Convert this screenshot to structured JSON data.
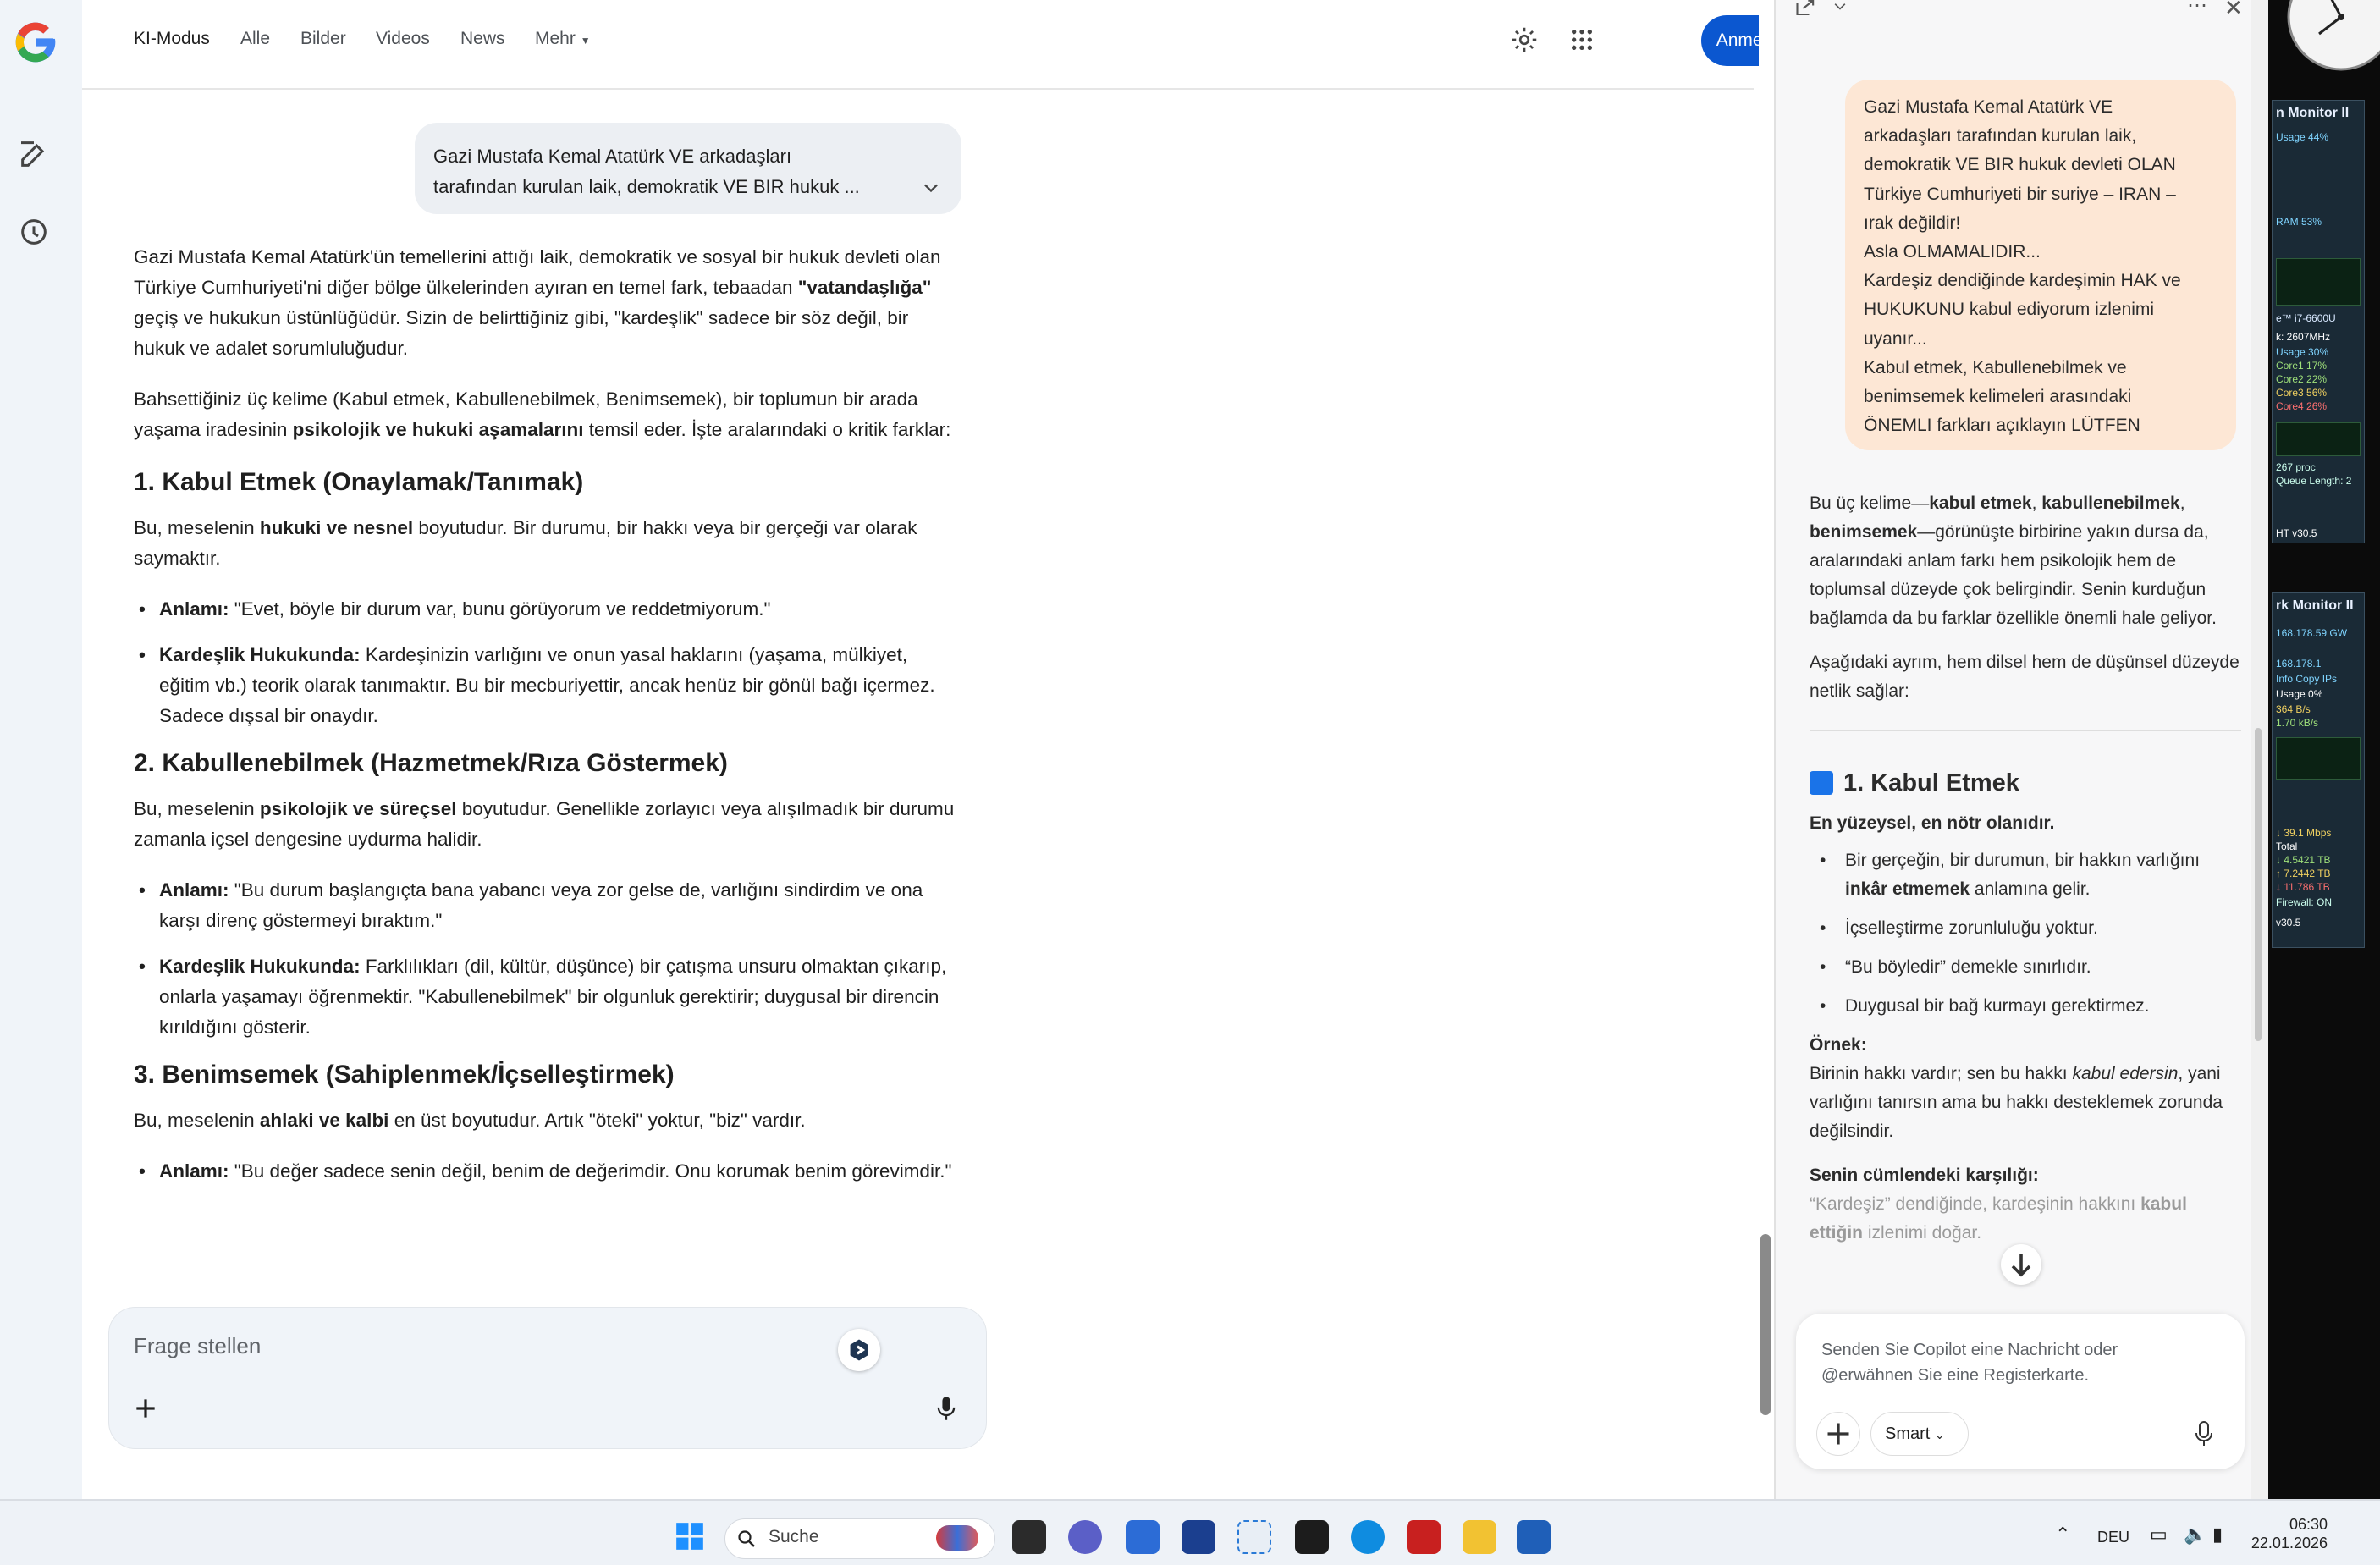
{
  "nav": {
    "tabs": [
      "KI-Modus",
      "Alle",
      "Bilder",
      "Videos",
      "News",
      "Mehr"
    ],
    "signin": "Anmelden"
  },
  "query": {
    "line1": "Gazi Mustafa Kemal Atatürk VE arkadaşları",
    "line2": "tarafından kurulan laik, demokratik VE BIR hukuk ..."
  },
  "answer": {
    "intro": [
      "Gazi Mustafa Kemal Atatürk'ün temellerini attığı laik, demokratik ve sosyal bir hukuk devleti olan Türkiye Cumhuriyeti'ni diğer bölge ülkelerinden ayıran en temel fark, tebaadan ",
      "\"vatandaşlığa\"",
      " geçiş ve hukukun üstünlüğüdür. Sizin de belirttiğiniz gibi, \"kardeşlik\" sadece bir söz değil, bir hukuk ve adalet sorumluluğudur."
    ],
    "para2": [
      "Bahsettiğiniz üç kelime (Kabul etmek, Kabullenebilmek, Benimsemek), bir toplumun bir arada yaşama iradesinin ",
      "psikolojik ve hukuki aşamalarını",
      " temsil eder. İşte aralarındaki o kritik farklar:"
    ],
    "s1": {
      "title": "1. Kabul Etmek (Onaylamak/Tanımak)",
      "p": [
        "Bu, meselenin ",
        "hukuki ve nesnel",
        " boyutudur. Bir durumu, bir hakkı veya bir gerçeği var olarak saymaktır."
      ],
      "b1_label": "Anlamı:",
      "b1": " \"Evet, böyle bir durum var, bunu görüyorum ve reddetmiyorum.\"",
      "b2_label": "Kardeşlik Hukukunda:",
      "b2": " Kardeşinizin varlığını ve onun yasal haklarını (yaşama, mülkiyet, eğitim vb.) teorik olarak tanımaktır. Bu bir mecburiyettir, ancak henüz bir gönül bağı içermez. Sadece dışsal bir onaydır."
    },
    "s2": {
      "title": "2. Kabullenebilmek (Hazmetmek/Rıza Göstermek)",
      "p": [
        "Bu, meselenin ",
        "psikolojik ve süreçsel",
        " boyutudur. Genellikle zorlayıcı veya alışılmadık bir durumu zamanla içsel dengesine uydurma halidir."
      ],
      "b1_label": "Anlamı:",
      "b1": " \"Bu durum başlangıçta bana yabancı veya zor gelse de, varlığını sindirdim ve ona karşı direnç göstermeyi bıraktım.\"",
      "b2_label": "Kardeşlik Hukukunda:",
      "b2": " Farklılıkları (dil, kültür, düşünce) bir çatışma unsuru olmaktan çıkarıp, onlarla yaşamayı öğrenmektir. \"Kabullenebilmek\" bir olgunluk gerektirir; duygusal bir direncin kırıldığını gösterir."
    },
    "s3": {
      "title": "3. Benimsemek (Sahiplenmek/İçselleştirmek)",
      "p": [
        "Bu, meselenin ",
        "ahlaki ve kalbi",
        " en üst boyutudur. Artık \"öteki\" yoktur, \"biz\" vardır."
      ],
      "b1_label": "Anlamı:",
      "b1": " \"Bu değer sadece senin değil, benim de değerimdir. Onu korumak benim görevimdir.\""
    }
  },
  "ask": {
    "placeholder": "Frage stellen"
  },
  "copilot": {
    "user_lines": [
      "Gazi Mustafa Kemal Atatürk VE",
      "arkadaşları tarafından kurulan laik,",
      "demokratik VE BIR hukuk devleti OLAN",
      "Türkiye Cumhuriyeti bir suriye – IRAN –",
      "ırak değildir!",
      "Asla OLMAMALIDIR...",
      "Kardeşiz dendiğinde kardeşimin HAK ve",
      "HUKUKUNU kabul ediyorum izlenimi",
      "uyanır...",
      "Kabul etmek, Kabullenebilmek ve",
      "benimsemek kelimeleri arasındaki",
      "ÖNEMLI farkları açıklayın LÜTFEN"
    ],
    "p1": [
      "Bu üç kelime—",
      "kabul etmek",
      ", ",
      "kabullenebilmek",
      ", ",
      "benimsemek",
      "—görünüşte birbirine yakın dursa da, aralarındaki anlam farkı hem psikolojik hem de toplumsal düzeyde çok belirgindir. Senin kurduğun bağlamda da bu farklar özellikle önemli hale geliyor."
    ],
    "p2": "Aşağıdaki ayrım, hem dilsel hem de düşünsel düzeyde netlik sağlar:",
    "h1": "1. Kabul Etmek",
    "sub": "En yüzeysel, en nötr olanıdır.",
    "bullets": [
      [
        "Bir gerçeğin, bir durumun, bir hakkın varlığını ",
        "inkâr etmemek",
        " anlamına gelir."
      ],
      [
        "İçselleştirme zorunluluğu yoktur.",
        "",
        ""
      ],
      [
        "“Bu böyledir” demekle sınırlıdır.",
        "",
        ""
      ],
      [
        "Duygusal bir bağ kurmayı gerektirmez.",
        "",
        ""
      ]
    ],
    "example_label": "Örnek:",
    "example": [
      "Birinin hakkı vardır; sen bu hakkı ",
      "kabul edersin",
      ", yani varlığını tanırsın ama bu hakkı desteklemek zorunda değilsindir."
    ],
    "sentence_label": "Senin cümlendeki karşılığı:",
    "sentence": [
      "“Kardeşiz” dendiğinde, kardeşinin hakkını ",
      "kabul ettiğin",
      " izlenimi doğar."
    ],
    "input_placeholder": "Senden Sie Copilot eine Nachricht oder @erwähnen Sie eine Registerkarte.",
    "mode": "Smart"
  },
  "desktop": {
    "w1_title": "n Monitor II",
    "w1_lines": [
      "Usage 44%",
      "RAM 53%",
      "e™ i7-6600U",
      "k: 2607MHz",
      "Usage 30%",
      "Core1 17%",
      "Core2 22%",
      "Core3 56%",
      "Core4 26%",
      "267 proc",
      "Queue Length: 2",
      "HT v30.5"
    ],
    "w2_title": "rk Monitor II",
    "w2_lines": [
      "168.178.59 GW",
      "168.178.1",
      "Info Copy IPs",
      "Usage 0%",
      "364 B/s",
      "1.70 kB/s",
      "↓ 39.1 Mbps",
      "Total",
      "↓ 4.5421 TB",
      "↑ 7.2442 TB",
      "↓ 11.786 TB",
      "Firewall: ON",
      "v30.5"
    ]
  },
  "taskbar": {
    "search": "Suche",
    "lang": "DEU",
    "time": "06:30",
    "date": "22.01.2026"
  },
  "colors": {
    "accent": "#0b57d0",
    "user_bubble": "#fde7d5",
    "query_bubble": "#eceff3"
  }
}
